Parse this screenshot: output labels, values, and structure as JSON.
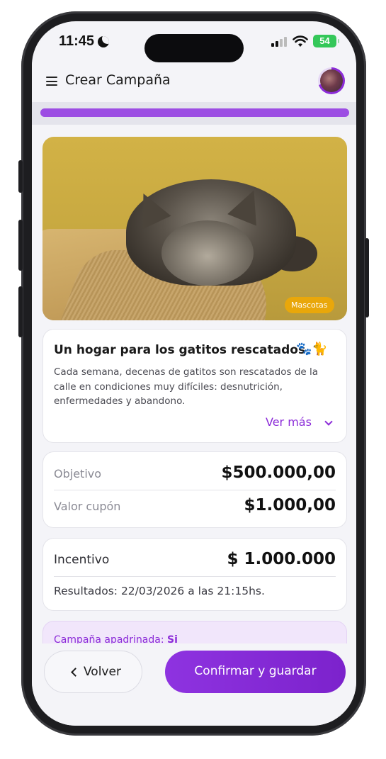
{
  "status_bar": {
    "time": "11:45",
    "battery": "54"
  },
  "header": {
    "title": "Crear Campaña",
    "menu_icon": "hamburger-icon",
    "avatar_icon": "user-avatar"
  },
  "progress": {
    "value": 1.0,
    "color": "#9c4de3"
  },
  "campaign": {
    "image": "sleeping-tabby-cat-photo",
    "category": "Mascotas",
    "title": "Un hogar para los gatitos rescatados",
    "title_emoji": "🐾🐈",
    "description": "Cada semana, decenas de gatitos son rescatados de la calle en condiciones muy difíciles: desnutrición, enfermedades y abandono.",
    "see_more": "Ver más"
  },
  "amounts": {
    "goal_label": "Objetivo",
    "goal_value": "$500.000,00",
    "coupon_label": "Valor cupón",
    "coupon_value": "$1.000,00"
  },
  "incentive": {
    "label": "Incentivo",
    "value": "$ 1.000.000",
    "results": "Resultados: 22/03/2026 a las 21:15hs."
  },
  "sponsor": {
    "label": "Campaña apadrinada:",
    "value": "Si"
  },
  "footer": {
    "back_label": "Volver",
    "confirm_label": "Confirmar y guardar"
  },
  "colors": {
    "accent": "#8b2bd8",
    "tag": "#e9a70a",
    "battery": "#34c759"
  }
}
